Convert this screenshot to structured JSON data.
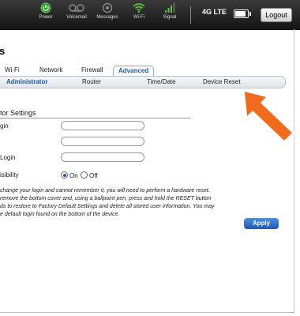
{
  "topbar": {
    "items": [
      {
        "label": "Power",
        "icon": "power-icon"
      },
      {
        "label": "Voicemail",
        "icon": "voicemail-icon"
      },
      {
        "label": "Messages",
        "icon": "messages-icon"
      },
      {
        "label": "Wi-Fi",
        "icon": "wifi-icon"
      },
      {
        "label": "Signal",
        "icon": "signal-icon"
      }
    ],
    "network": "4G LTE",
    "battery_level": 0.75,
    "logout_label": "Logout"
  },
  "page": {
    "title": "s"
  },
  "tabs": [
    {
      "label": "Wi-Fi",
      "active": false
    },
    {
      "label": "Network",
      "active": false
    },
    {
      "label": "Firewall",
      "active": false
    },
    {
      "label": "Advanced",
      "active": true
    }
  ],
  "subtabs": [
    {
      "label": "Administrator",
      "active": true
    },
    {
      "label": "Router",
      "active": false
    },
    {
      "label": "Time/Date",
      "active": false
    },
    {
      "label": "Device Reset",
      "active": false
    }
  ],
  "section": {
    "title": "tor Settings",
    "fields": [
      {
        "label": "gin",
        "value": ""
      },
      {
        "label": "",
        "value": ""
      },
      {
        "label": "Login",
        "value": ""
      },
      {
        "label": "",
        "value": ""
      }
    ],
    "visibility": {
      "label": "isibility",
      "options": [
        {
          "label": "On",
          "selected": true
        },
        {
          "label": "Off",
          "selected": false
        }
      ]
    },
    "note_lines": [
      "change your login and cannot remember it, you will need to perform a hardware reset.",
      "remove the bottom cover and, using a ballpoint pen, press and hold the RESET button",
      "ds to restore to Factory Default Settings and delete all stored user information. You may",
      "e default login found on the bottom of the device."
    ],
    "apply_label": "Apply"
  },
  "colors": {
    "accent": "#1a5aa6",
    "arrow": "#f26a1b",
    "wifi_active": "#5cc43c"
  }
}
